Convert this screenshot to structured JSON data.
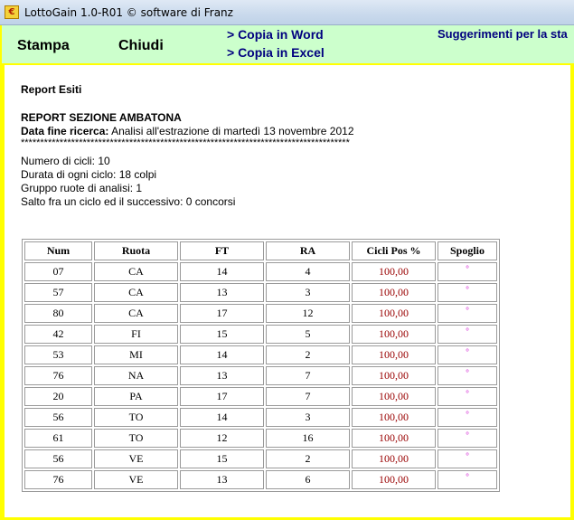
{
  "window": {
    "title": "LottoGain 1.0-R01    © software di Franz",
    "icon": "lottogain-app-icon"
  },
  "toolbar": {
    "stampa_label": "Stampa",
    "chiudi_label": "Chiudi",
    "copia_word_label": "> Copia in Word",
    "copia_excel_label": "> Copia in Excel",
    "suggerimenti_label": "Suggerimenti per la sta"
  },
  "report": {
    "heading": "Report Esiti",
    "section_title": "REPORT SEZIONE AMBATONA",
    "data_fine_label": "Data fine ricerca:",
    "data_fine_value": " Analisi all'estrazione di martedì 13 novembre 2012",
    "separator": "*************************************************************************************",
    "params": [
      "Numero di cicli: 10",
      "Durata di ogni ciclo: 18 colpi",
      "Gruppo ruote di analisi: 1",
      "Salto fra un ciclo ed il successivo: 0 concorsi"
    ]
  },
  "table": {
    "headers": [
      "Num",
      "Ruota",
      "FT",
      "RA",
      "Cicli Pos %",
      "Spoglio"
    ],
    "rows": [
      [
        "07",
        "CA",
        "14",
        "4",
        "100,00",
        "°"
      ],
      [
        "57",
        "CA",
        "13",
        "3",
        "100,00",
        "°"
      ],
      [
        "80",
        "CA",
        "17",
        "12",
        "100,00",
        "°"
      ],
      [
        "42",
        "FI",
        "15",
        "5",
        "100,00",
        "°"
      ],
      [
        "53",
        "MI",
        "14",
        "2",
        "100,00",
        "°"
      ],
      [
        "76",
        "NA",
        "13",
        "7",
        "100,00",
        "°"
      ],
      [
        "20",
        "PA",
        "17",
        "7",
        "100,00",
        "°"
      ],
      [
        "56",
        "TO",
        "14",
        "3",
        "100,00",
        "°"
      ],
      [
        "61",
        "TO",
        "12",
        "16",
        "100,00",
        "°"
      ],
      [
        "56",
        "VE",
        "15",
        "2",
        "100,00",
        "°"
      ],
      [
        "76",
        "VE",
        "13",
        "6",
        "100,00",
        "°"
      ]
    ]
  },
  "colors": {
    "frame": "#ffff00",
    "toolbar_bg": "#ccffcc",
    "link": "#00007f",
    "percent": "#990000",
    "spoglio": "#cc00cc"
  }
}
